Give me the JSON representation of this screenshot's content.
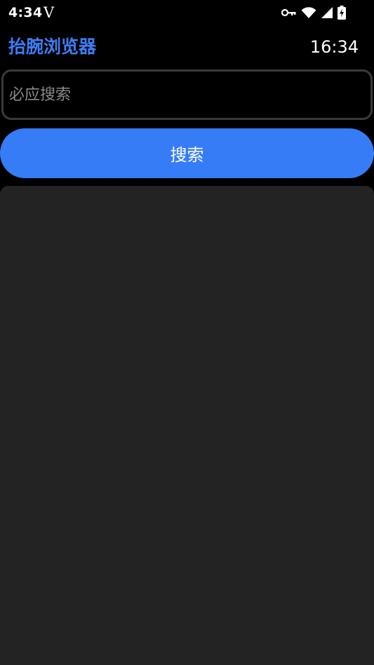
{
  "status_bar": {
    "time": "4:34",
    "app_glyph": "V",
    "icons": [
      "key-icon",
      "wifi-icon",
      "signal-icon",
      "battery-charging-icon"
    ]
  },
  "header": {
    "title": "抬腕浏览器",
    "clock": "16:34"
  },
  "search": {
    "placeholder": "必应搜索",
    "value": "",
    "button_label": "搜索"
  },
  "colors": {
    "accent": "#367cf7",
    "title": "#3d7ef5",
    "background": "#000000",
    "panel": "#232323",
    "input_border": "#3a3a3a"
  }
}
